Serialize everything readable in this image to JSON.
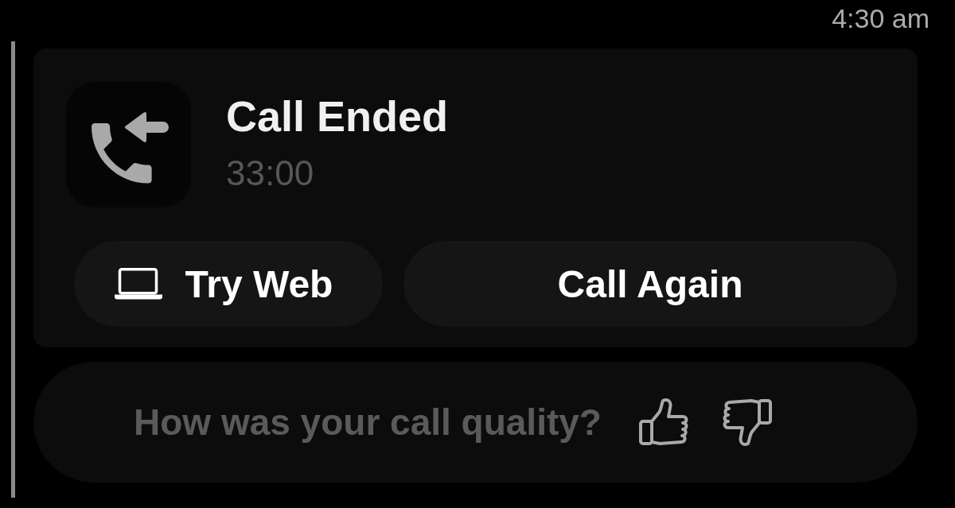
{
  "status_bar": {
    "time": "4:30 am"
  },
  "call_card": {
    "title": "Call Ended",
    "duration": "33:00",
    "buttons": [
      {
        "label": "Try Web",
        "kind": "web"
      },
      {
        "label": "Call Again",
        "kind": "call"
      }
    ]
  },
  "feedback": {
    "prompt": "How was your call quality?",
    "ratings": [
      {
        "kind": "thumbs_up",
        "selected": false
      },
      {
        "kind": "thumbs_down",
        "selected": false
      }
    ]
  }
}
